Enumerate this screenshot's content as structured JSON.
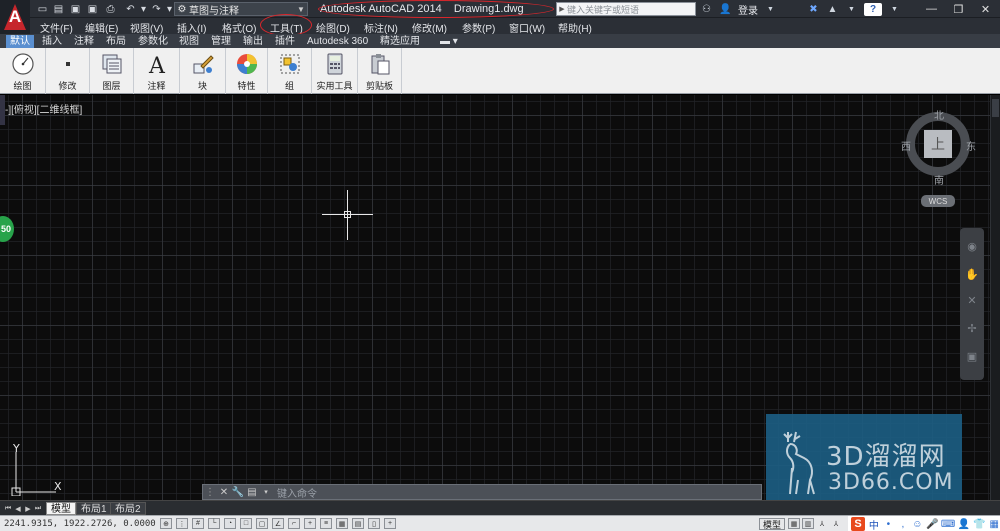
{
  "titlebar": {
    "workspace": "草图与注释",
    "app_title": "Autodesk AutoCAD 2014    Drawing1.dwg",
    "search_placeholder": "键入关键字或短语",
    "login_label": "登录",
    "help_label": "?"
  },
  "menu": [
    "文件(F)",
    "编辑(E)",
    "视图(V)",
    "插入(I)",
    "格式(O)",
    "工具(T)",
    "绘图(D)",
    "标注(N)",
    "修改(M)",
    "参数(P)",
    "窗口(W)",
    "帮助(H)"
  ],
  "ribbon_tabs": [
    {
      "label": "默认",
      "active": true
    },
    {
      "label": "插入",
      "active": false
    },
    {
      "label": "注释",
      "active": false
    },
    {
      "label": "布局",
      "active": false
    },
    {
      "label": "参数化",
      "active": false
    },
    {
      "label": "视图",
      "active": false
    },
    {
      "label": "管理",
      "active": false
    },
    {
      "label": "输出",
      "active": false
    },
    {
      "label": "插件",
      "active": false
    },
    {
      "label": "Autodesk 360",
      "active": false
    },
    {
      "label": "精选应用",
      "active": false
    }
  ],
  "ribbon_panels": [
    {
      "label": "绘图",
      "icon": "draw-icon"
    },
    {
      "label": "修改",
      "icon": "modify-icon"
    },
    {
      "label": "图层",
      "icon": "layers-icon"
    },
    {
      "label": "注释",
      "icon": "annotation-icon"
    },
    {
      "label": "块",
      "icon": "block-icon"
    },
    {
      "label": "特性",
      "icon": "properties-icon"
    },
    {
      "label": "组",
      "icon": "group-icon"
    },
    {
      "label": "实用工具",
      "icon": "utilities-icon"
    },
    {
      "label": "剪贴板",
      "icon": "clipboard-icon"
    }
  ],
  "viewport_label": "-][俯视][二维线框]",
  "viewcube": {
    "face": "上",
    "north": "北",
    "south": "南",
    "east": "东",
    "west": "西",
    "wcs": "WCS"
  },
  "green_badge": "50",
  "ucs": {
    "x": "X",
    "y": "Y"
  },
  "command": {
    "placeholder": "键入命令"
  },
  "layout_tabs": [
    {
      "label": "模型",
      "active": true
    },
    {
      "label": "布局1",
      "active": false
    },
    {
      "label": "布局2",
      "active": false
    }
  ],
  "statusbar": {
    "coordinates": "2241.9315, 1922.2726, 0.0000",
    "model_label": "模型",
    "ime_label": "中"
  },
  "watermark": {
    "title": "3D溜溜网",
    "subtitle": "3D66.COM"
  },
  "colors": {
    "accent_red": "#d8262b",
    "active_tab": "#5a8fd0",
    "canvas": "#0c0c0c",
    "watermark": "#1c5d82"
  }
}
